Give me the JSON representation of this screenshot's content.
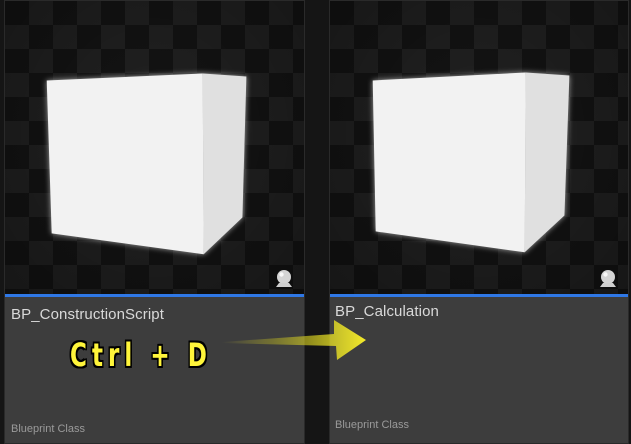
{
  "assets": [
    {
      "name": "BP_ConstructionScript",
      "type": "Blueprint Class",
      "thumbnail_icon": "cube-thumbnail-icon",
      "preview_icon": "static-mesh-preview-icon"
    },
    {
      "name": "BP_Calculation",
      "type": "Blueprint Class",
      "thumbnail_icon": "cube-thumbnail-icon",
      "preview_icon": "static-mesh-preview-icon"
    }
  ],
  "annotation": {
    "shortcut": "Ctrl + D",
    "arrow_icon": "right-arrow-icon",
    "text_color": "#fff53a"
  },
  "colors": {
    "accent": "#2f78e6",
    "tile_background": "#3d3d3d"
  }
}
